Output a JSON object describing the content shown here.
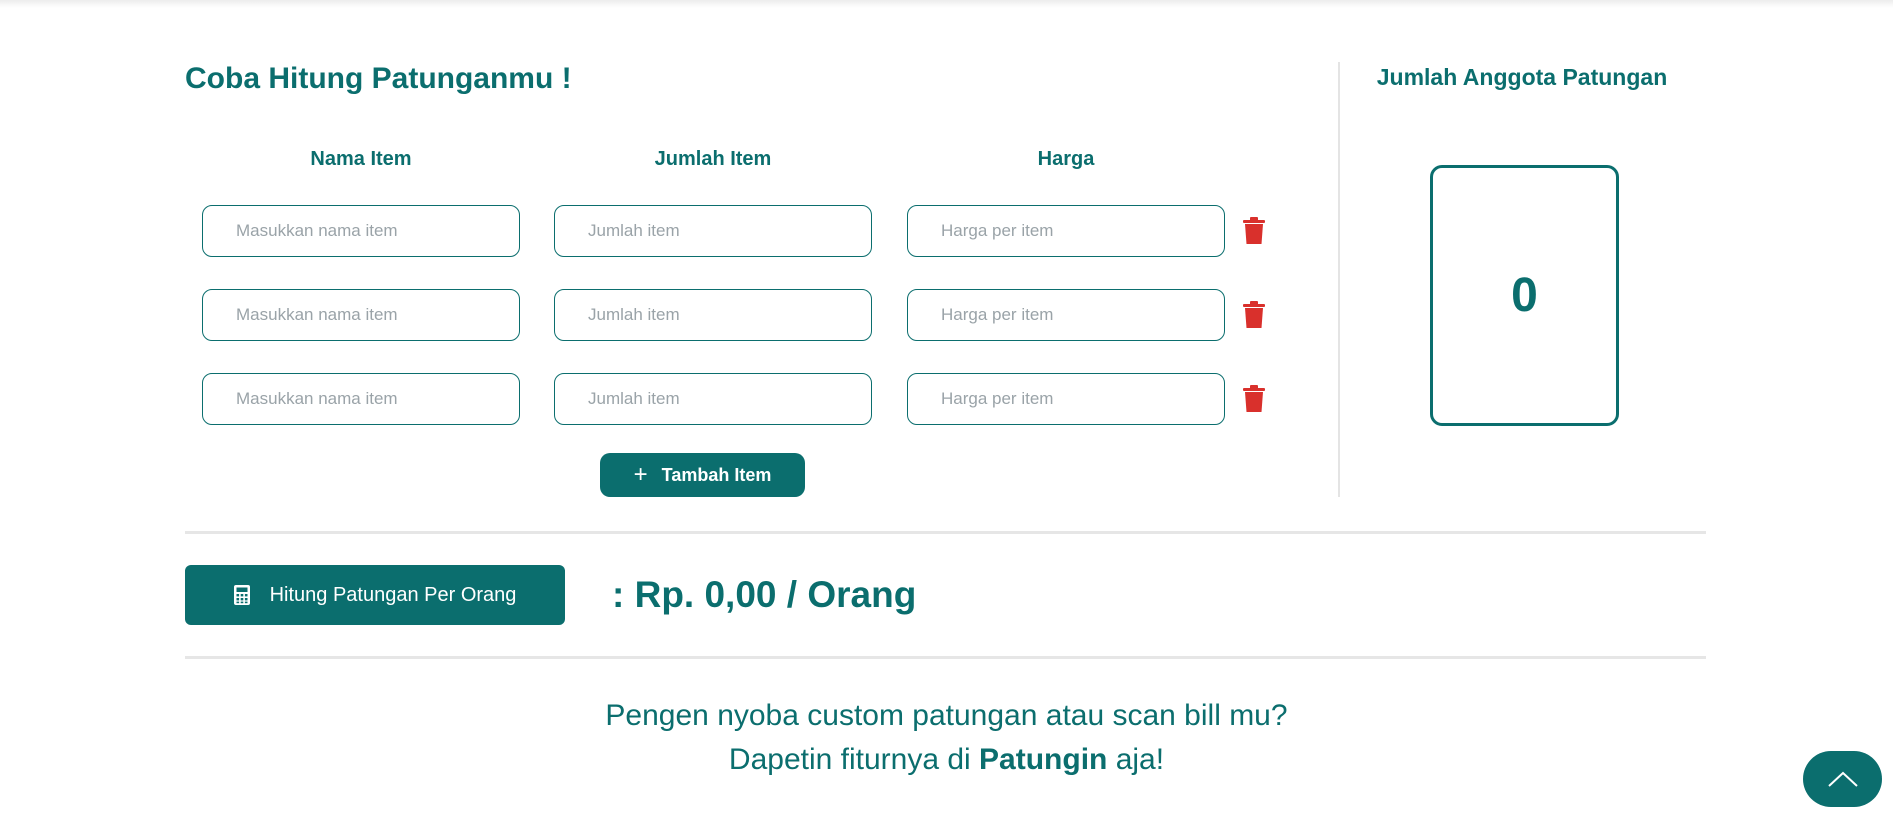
{
  "calculator": {
    "title": "Coba Hitung Patunganmu !",
    "columns": {
      "name": "Nama Item",
      "qty": "Jumlah Item",
      "price": "Harga"
    },
    "placeholders": {
      "name": "Masukkan nama item",
      "qty": "Jumlah item",
      "price": "Harga per item"
    },
    "rows": [
      {
        "name": "",
        "qty": "",
        "price": "",
        "delete_icon": "trash-icon"
      },
      {
        "name": "",
        "qty": "",
        "price": "",
        "delete_icon": "trash-icon"
      },
      {
        "name": "",
        "qty": "",
        "price": "",
        "delete_icon": "trash-icon"
      }
    ],
    "add_button": {
      "icon": "plus-icon",
      "label": "Tambah Item"
    }
  },
  "members": {
    "title": "Jumlah Anggota Patungan",
    "count": "0"
  },
  "result": {
    "button_icon": "calculator-icon",
    "button_label": "Hitung Patungan Per Orang",
    "text": ": Rp. 0,00 / Orang"
  },
  "promo": {
    "line1": "Pengen nyoba custom patungan atau scan bill mu?",
    "line2_prefix": "Dapetin fiturnya di ",
    "line2_brand": "Patungin",
    "line2_suffix": " aja!"
  },
  "scroll_top": {
    "icon": "chevron-up-icon"
  },
  "colors": {
    "primary": "#0b6e6e",
    "danger": "#d9302c",
    "divider": "#e6e6e6"
  }
}
